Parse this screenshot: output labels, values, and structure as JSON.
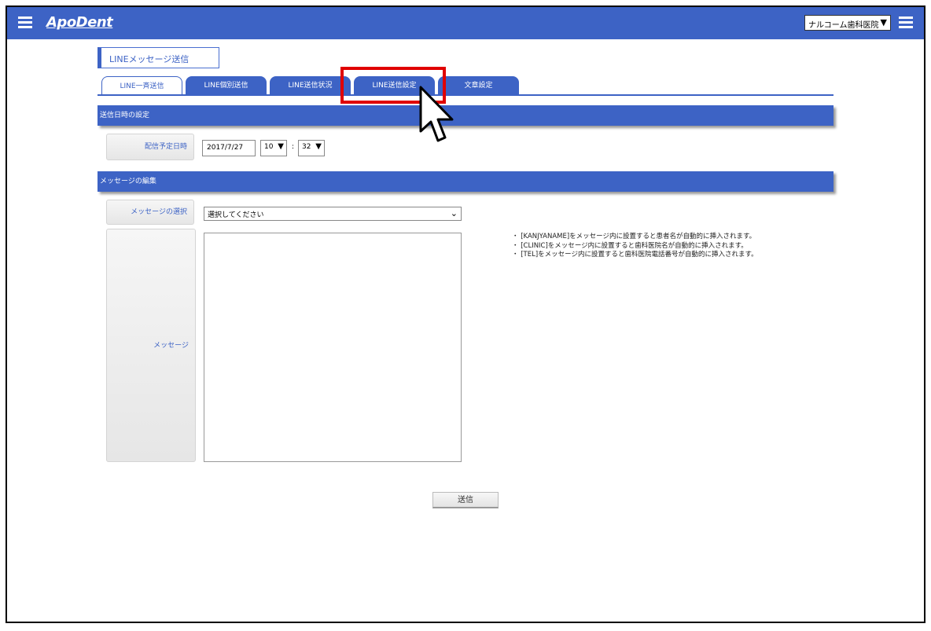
{
  "header": {
    "logo": "ApoDent",
    "clinic_select": "ナルコーム歯科医院"
  },
  "page": {
    "title": "LINEメッセージ送信"
  },
  "tabs": [
    {
      "label": "LINE一斉送信",
      "active": true
    },
    {
      "label": "LINE個別送信",
      "active": false
    },
    {
      "label": "LINE送信状況",
      "active": false
    },
    {
      "label": "LINE送信設定",
      "active": false
    },
    {
      "label": "文章設定",
      "active": false
    }
  ],
  "schedule": {
    "section_title": "送信日時の設定",
    "label": "配信予定日時",
    "date": "2017/7/27",
    "hour": "10",
    "separator": ":",
    "minute": "32"
  },
  "message": {
    "section_title": "メッセージの編集",
    "select_label": "メッセージの選択",
    "select_value": "選択してください",
    "message_label": "メッセージ",
    "message_value": "",
    "notes": [
      "・ [KANJYANAME]をメッセージ内に設置すると患者名が自動的に挿入されます。",
      "・ [CLINIC]をメッセージ内に設置すると歯科医院名が自動的に挿入されます。",
      "・ [TEL]をメッセージ内に設置すると歯科医院電話番号が自動的に挿入されます。"
    ]
  },
  "actions": {
    "send_label": "送信"
  },
  "colors": {
    "primary": "#3d63c5",
    "highlight": "#e00000"
  },
  "icons": [
    "menu-icon",
    "chevron-down-icon",
    "cursor-arrow-icon"
  ]
}
